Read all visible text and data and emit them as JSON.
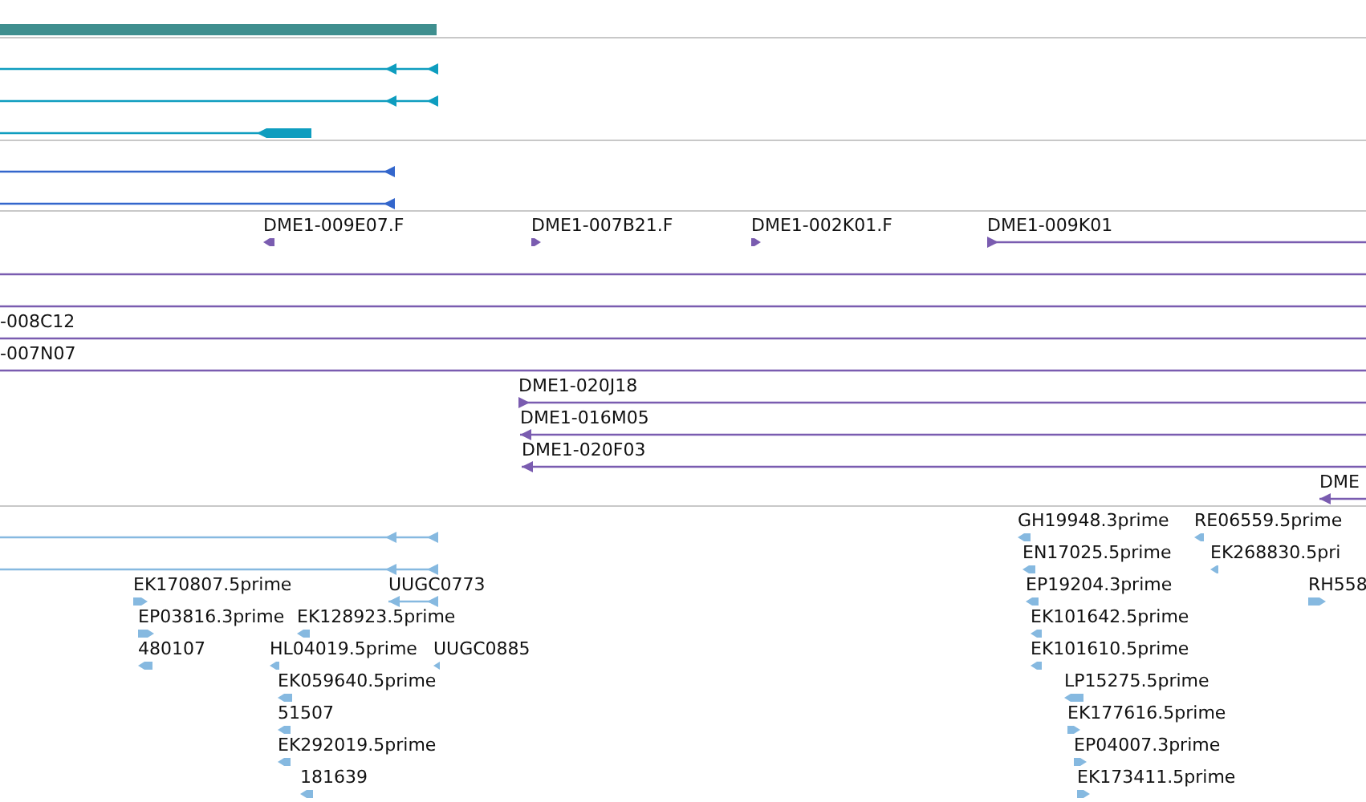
{
  "tracks": [
    {
      "kind": "coverage"
    },
    {
      "kind": "mrna",
      "features": [
        {
          "kind": "spliced",
          "reverse": true
        },
        {
          "kind": "spliced",
          "reverse": true
        },
        {
          "kind": "coding",
          "reverse": true
        }
      ]
    },
    {
      "kind": "cds",
      "features": [
        {
          "kind": "line",
          "reverse": true
        },
        {
          "kind": "line",
          "reverse": true
        }
      ]
    },
    {
      "kind": "clones",
      "features": [
        {
          "kind": "read",
          "label": "DME1-009E07.F",
          "reverse": true
        },
        {
          "kind": "read",
          "label": "DME1-007B21.F",
          "reverse": false
        },
        {
          "kind": "read",
          "label": "DME1-002K01.F",
          "reverse": false
        },
        {
          "kind": "line",
          "label": "DME1-009K01",
          "reverse": false
        },
        {
          "kind": "line"
        },
        {
          "kind": "line"
        },
        {
          "kind": "line",
          "label": "-008C12"
        },
        {
          "kind": "line",
          "label": "-007N07"
        },
        {
          "kind": "line",
          "label": "DME1-020J18",
          "reverse": false
        },
        {
          "kind": "line",
          "label": "DME1-016M05",
          "reverse": true
        },
        {
          "kind": "line",
          "label": "DME1-020F03",
          "reverse": true
        },
        {
          "kind": "line",
          "label": "DME",
          "reverse": true
        }
      ]
    },
    {
      "kind": "ests",
      "features": [
        {
          "kind": "spliced",
          "reverse": true
        },
        {
          "kind": "read",
          "label": "GH19948.3prime",
          "reverse": true
        },
        {
          "kind": "read",
          "label": "RE06559.5prime",
          "reverse": true
        },
        {
          "kind": "spliced",
          "reverse": true
        },
        {
          "kind": "read",
          "label": "EN17025.5prime",
          "reverse": true
        },
        {
          "kind": "read",
          "label": "EK268830.5pri",
          "reverse": true
        },
        {
          "kind": "read",
          "label": "EK170807.5prime",
          "reverse": false
        },
        {
          "kind": "spliced",
          "label": "UUGC0773",
          "reverse": true
        },
        {
          "kind": "read",
          "label": "EP19204.3prime",
          "reverse": true
        },
        {
          "kind": "read",
          "label": "RH558",
          "reverse": false
        },
        {
          "kind": "read",
          "label": "EP03816.3prime",
          "reverse": false
        },
        {
          "kind": "read",
          "label": "EK128923.5prime",
          "reverse": true
        },
        {
          "kind": "read",
          "label": "EK101642.5prime",
          "reverse": true
        },
        {
          "kind": "read",
          "label": "480107",
          "reverse": true
        },
        {
          "kind": "read",
          "label": "HL04019.5prime",
          "reverse": true
        },
        {
          "kind": "read",
          "label": "UUGC0885",
          "reverse": true
        },
        {
          "kind": "read",
          "label": "EK101610.5prime",
          "reverse": true
        },
        {
          "kind": "read",
          "label": "EK059640.5prime",
          "reverse": true
        },
        {
          "kind": "read",
          "label": "LP15275.5prime",
          "reverse": true
        },
        {
          "kind": "read",
          "label": "51507",
          "reverse": true
        },
        {
          "kind": "read",
          "label": "EK177616.5prime",
          "reverse": false
        },
        {
          "kind": "read",
          "label": "EK292019.5prime",
          "reverse": true
        },
        {
          "kind": "read",
          "label": "EP04007.3prime",
          "reverse": false
        },
        {
          "kind": "read",
          "label": "181639",
          "reverse": true
        },
        {
          "kind": "read",
          "label": "EK173411.5prime",
          "reverse": false
        }
      ]
    }
  ]
}
